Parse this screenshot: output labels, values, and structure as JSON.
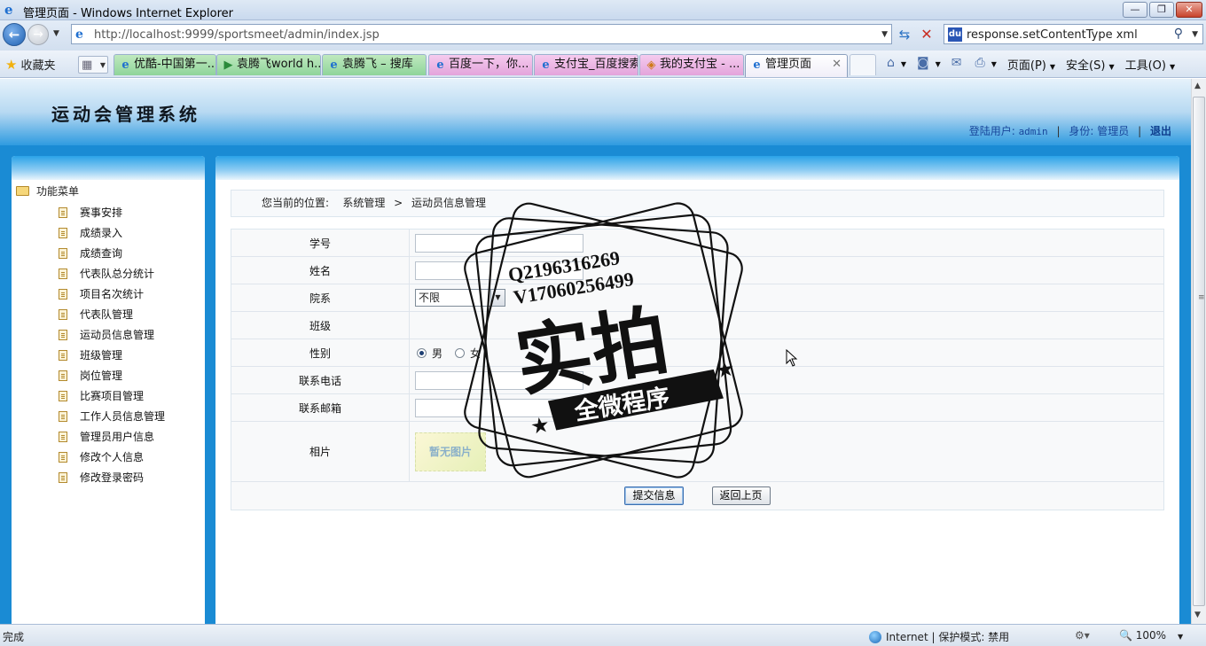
{
  "browser": {
    "window_title": "管理页面 - Windows Internet Explorer",
    "url": "http://localhost:9999/sportsmeet/admin/index.jsp",
    "search_query": "response.setContentType xml",
    "favorites_label": "收藏夹",
    "tabs": [
      {
        "label": "优酷-中国第一...",
        "color": "green"
      },
      {
        "label": "袁腾飞world h...",
        "color": "green"
      },
      {
        "label": "袁腾飞 – 搜库",
        "color": "green"
      },
      {
        "label": "百度一下，你...",
        "color": "pink"
      },
      {
        "label": "支付宝_百度搜索",
        "color": "pink"
      },
      {
        "label": "我的支付宝 - ...",
        "color": "pink"
      },
      {
        "label": "管理页面",
        "color": "active"
      }
    ],
    "commands": {
      "page": "页面(P)",
      "safety": "安全(S)",
      "tools": "工具(O)"
    },
    "status": {
      "left": "完成",
      "zone": "Internet | 保护模式: 禁用",
      "zoom": "100%"
    }
  },
  "site": {
    "title": "运动会管理系统",
    "user_label": "登陆用户:",
    "user_name": "admin",
    "role_label": "身份:",
    "role": "管理员",
    "logout": "退出"
  },
  "sidebar": {
    "root": "功能菜单",
    "items": [
      "赛事安排",
      "成绩录入",
      "成绩查询",
      "代表队总分统计",
      "项目名次统计",
      "代表队管理",
      "运动员信息管理",
      "班级管理",
      "岗位管理",
      "比赛项目管理",
      "工作人员信息管理",
      "管理员用户信息",
      "修改个人信息",
      "修改登录密码"
    ]
  },
  "breadcrumb": {
    "prefix": "您当前的位置:",
    "level1": "系统管理",
    "arrow": ">",
    "level2": "运动员信息管理"
  },
  "form": {
    "labels": {
      "student_id": "学号",
      "name": "姓名",
      "department": "院系",
      "class": "班级",
      "gender": "性别",
      "phone": "联系电话",
      "email": "联系邮箱",
      "photo": "相片"
    },
    "department_selected": "不限",
    "gender_options": [
      "男",
      "女"
    ],
    "gender_selected": "男",
    "photo_placeholder": "暂无图片",
    "submit_button": "提交信息",
    "back_button": "返回上页"
  },
  "watermark": {
    "line1": "Q2196316269",
    "line2": "V17060256499",
    "big": "实拍",
    "banner": "全微程序"
  }
}
